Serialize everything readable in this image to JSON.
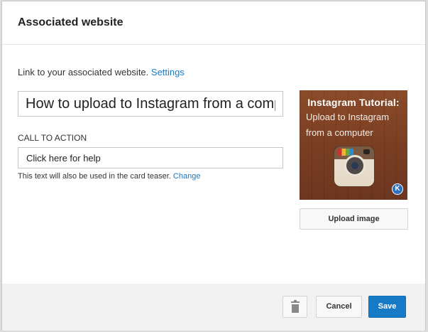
{
  "dialog": {
    "title": "Associated website"
  },
  "link_line": {
    "text": "Link to your associated website.",
    "settings_link": "Settings"
  },
  "title_field": {
    "value": "How to upload to Instagram from a comp"
  },
  "call_to_action": {
    "label": "CALL TO ACTION",
    "value": "Click here for help",
    "note": "This text will also be used in the card teaser.",
    "change_link": "Change"
  },
  "thumbnail": {
    "title": "Instagram Tutorial:",
    "line1": "Upload to Instagram",
    "line2": "from a computer",
    "badge": "K",
    "icon": "instagram-camera-icon"
  },
  "buttons": {
    "upload_image": "Upload image",
    "cancel": "Cancel",
    "save": "Save",
    "delete_icon": "trash-icon"
  },
  "colors": {
    "accent": "#167ac6",
    "footer_bg": "#f1f1f1",
    "thumb_wood": "#7a3f22"
  }
}
